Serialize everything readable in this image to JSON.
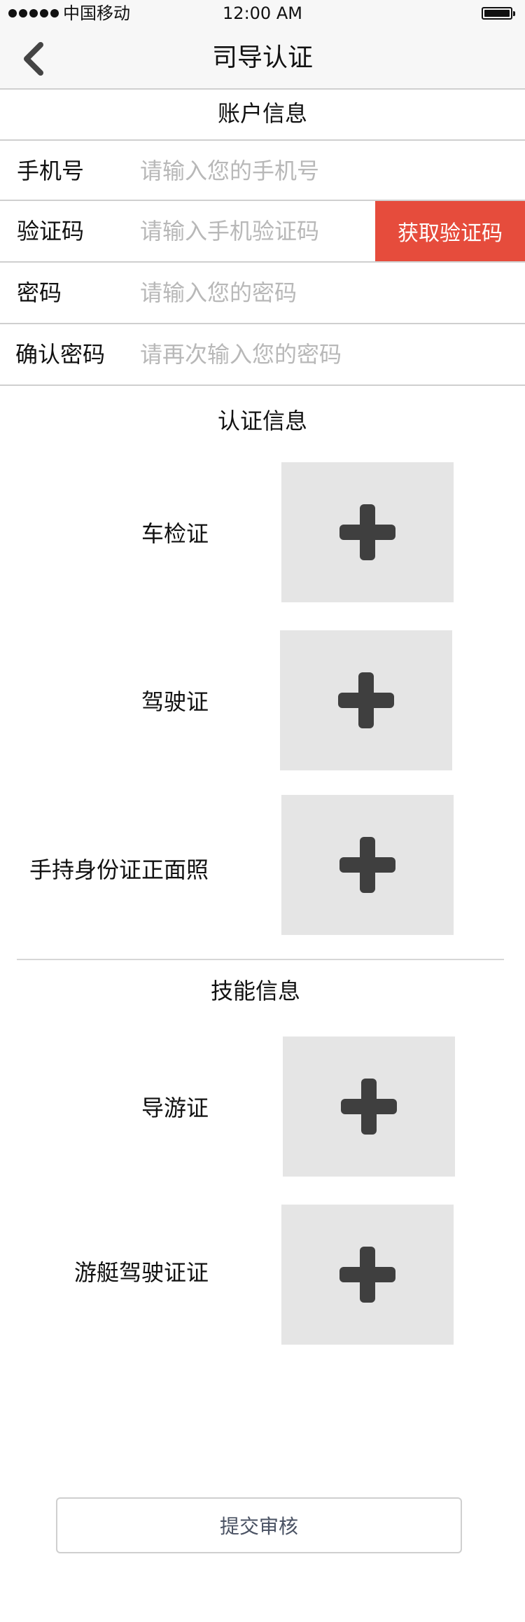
{
  "status_bar": {
    "carrier": "中国移动",
    "time": "12:00 AM"
  },
  "nav": {
    "title": "司导认证"
  },
  "account": {
    "title": "账户信息",
    "phone": {
      "label": "手机号",
      "placeholder": "请输入您的手机号"
    },
    "code": {
      "label": "验证码",
      "placeholder": "请输入手机验证码",
      "button": "获取验证码"
    },
    "password": {
      "label": "密码",
      "placeholder": "请输入您的密码"
    },
    "confirm": {
      "label": "确认密码",
      "placeholder": "请再次输入您的密码"
    }
  },
  "certification": {
    "title": "认证信息",
    "items": [
      {
        "label": "车检证"
      },
      {
        "label": "驾驶证"
      },
      {
        "label": "手持身份证正面照"
      }
    ]
  },
  "skills": {
    "title": "技能信息",
    "items": [
      {
        "label": "导游证"
      },
      {
        "label": "游艇驾驶证证"
      }
    ]
  },
  "submit": {
    "label": "提交审核"
  },
  "colors": {
    "accent": "#e64c3c",
    "upload_bg": "#e5e5e5",
    "placeholder": "#b8b8b8"
  },
  "icons": {
    "back": "chevron-left-icon",
    "add": "plus-icon"
  }
}
